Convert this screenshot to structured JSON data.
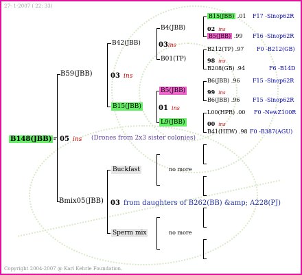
{
  "header": {
    "date": "27- 1-2007 ( 22: 33)"
  },
  "footer": {
    "copyright": "Copyright 2004-2007 @ Karl Kehrle Foundation."
  },
  "root": {
    "name": "B148(JBB)",
    "year": "05",
    "ins": "ins",
    "note": "(Drones from 2x3 sister colonies)"
  },
  "g1": [
    {
      "name": "B59(JBB)",
      "year": "03",
      "ins": "ins"
    },
    {
      "name": "Bmix05(JBB)",
      "year": "03",
      "note": "from daughters of B262(BB) &amp; A228(PJ)"
    }
  ],
  "g2": [
    {
      "name": "B42(JBB)"
    },
    {
      "name": "B15(JBB)",
      "year": "01",
      "ins": "ins"
    },
    {
      "name": "Buckfast"
    },
    {
      "name": "Sperm mix"
    }
  ],
  "g3": [
    {
      "name": "B4(JBB)",
      "year": "03",
      "ins": "ins"
    },
    {
      "name": "B01(TP)"
    },
    {
      "name": "B5(JBB)",
      "year": "99",
      "ins": "ins"
    },
    {
      "name": "L9(JBB)",
      "year": "00",
      "ins": "ins"
    }
  ],
  "more": [
    "no more",
    "no more"
  ],
  "g4": [
    {
      "name": "B15(JBB)",
      "val": ".01",
      "line": "F17 -Sinop62R"
    },
    {
      "name": "02",
      "ins": "ins"
    },
    {
      "name": "B5(JBB)",
      "val": ".99",
      "line": "F16 -Sinop62R"
    },
    {
      "name": "B212(TP)",
      "val": ".97",
      "line": "F0 -B212(GB)"
    },
    {
      "name": "98",
      "ins": "ins"
    },
    {
      "name": "B208(GB)",
      "val": ".94",
      "line": "F6 -B14D"
    },
    {
      "name": "B6(JBB)",
      "val": ".96",
      "line": "F15 -Sinop62R"
    },
    {
      "name": "99",
      "ins": "ins"
    },
    {
      "name": "B6(JBB)",
      "val": ".96",
      "line": "F15 -Sinop62R"
    },
    {
      "name": "L00(HPR)",
      "val": ".00",
      "line": "F0 -NewZ100R"
    },
    {
      "name": "00",
      "ins": "ins"
    },
    {
      "name": "B41(HEW)",
      "val": ".98",
      "line": "F0 -B387(AGU)"
    }
  ]
}
